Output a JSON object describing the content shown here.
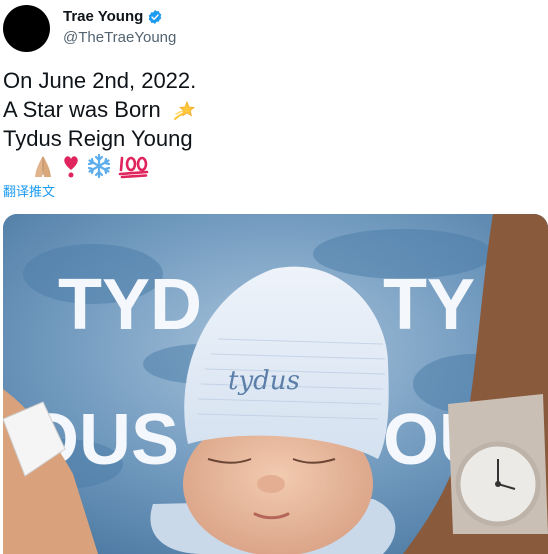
{
  "author": {
    "name": "Trae Young",
    "handle": "@TheTraeYoung",
    "verified": true
  },
  "tweet": {
    "lines": [
      "On June 2nd, 2022.",
      "A Star was Born",
      "Tydus Reign Young"
    ],
    "emojis_line2": [
      "dizzy-star-emoji"
    ],
    "emojis_line4": [
      "folded-hands-emoji",
      "heart-exclamation-emoji",
      "snowflake-emoji",
      "hundred-points-emoji"
    ],
    "translate_link": "翻译推文"
  },
  "media": {
    "backdrop_text_left": "TYD",
    "backdrop_text_right": "TY",
    "backdrop_text_lower_left": "OUS",
    "backdrop_text_lower_right": "OU",
    "hat_text": "tydus"
  },
  "colors": {
    "verified": "#1d9bf0",
    "link": "#1d9bf0",
    "handle": "#536471",
    "backdrop": "#7fa6c7"
  }
}
